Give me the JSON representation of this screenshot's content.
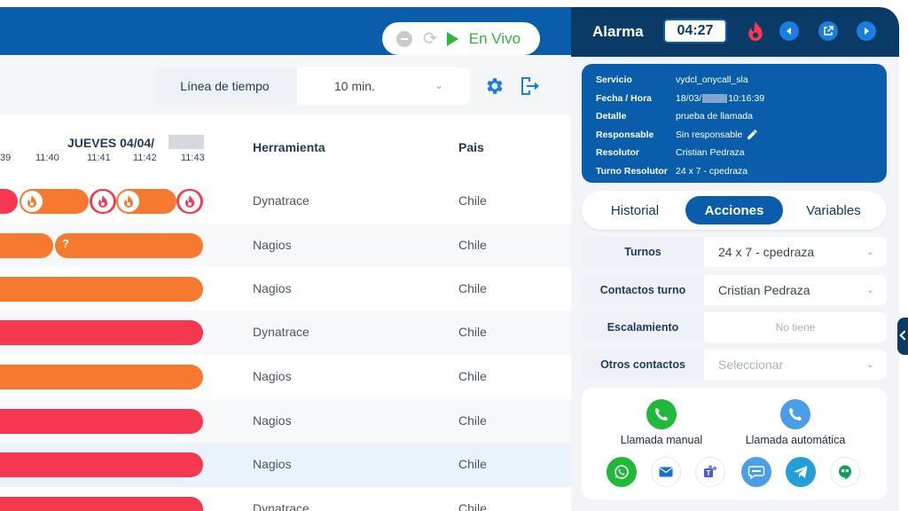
{
  "header": {
    "live_label": "En Vivo",
    "icons": [
      "stop-icon",
      "refresh-icon",
      "play-icon"
    ]
  },
  "controls": {
    "timeline_label": "Línea de tiempo",
    "interval_value": "10 min.",
    "icons": [
      "gear-icon",
      "exit-icon"
    ]
  },
  "table": {
    "date_heading": "JUEVES 04/04/",
    "ticks": [
      "39",
      "11:40",
      "11:41",
      "11:42",
      "11:43"
    ],
    "col_tool": "Herramienta",
    "col_country": "Pais",
    "rows": [
      {
        "tool": "Dynatrace",
        "country": "Chile"
      },
      {
        "tool": "Nagios",
        "country": "Chile"
      },
      {
        "tool": "Nagios",
        "country": "Chile"
      },
      {
        "tool": "Dynatrace",
        "country": "Chile"
      },
      {
        "tool": "Nagios",
        "country": "Chile"
      },
      {
        "tool": "Nagios",
        "country": "Chile"
      },
      {
        "tool": "Nagios",
        "country": "Chile"
      },
      {
        "tool": "Dynatrace",
        "country": "Chile"
      }
    ],
    "unknown_marker": "?",
    "colors": {
      "orange": "#f7782f",
      "red": "#f5384f",
      "selected_row": "#eaf2fb"
    }
  },
  "alarm": {
    "title": "Alarma",
    "timer": "04:27",
    "icons": [
      "flame-icon",
      "prev-icon",
      "external-link-icon",
      "next-icon"
    ],
    "info": {
      "servicio_key": "Servicio",
      "servicio_val": "vydcl_onycall_sla",
      "fecha_key": "Fecha / Hora",
      "fecha_val_a": "18/03/",
      "fecha_val_b": "10:16:39",
      "detalle_key": "Detalle",
      "detalle_val": "prueba de llamada",
      "responsable_key": "Responsable",
      "responsable_val": "Sin responsable",
      "resolutor_key": "Resolutor",
      "resolutor_val": "Cristian Pedraza",
      "turno_key": "Turno Resolutor",
      "turno_val": "24 x 7 - cpedraza"
    },
    "tabs": [
      "Historial",
      "Acciones",
      "Variables"
    ],
    "active_tab": "Acciones",
    "fields": {
      "turnos_label": "Turnos",
      "turnos_value": "24 x 7 - cpedraza",
      "contactos_label": "Contactos turno",
      "contactos_value": "Cristian Pedraza",
      "escalamiento_label": "Escalamiento",
      "escalamiento_value": "No tiene",
      "otros_label": "Otros contactos",
      "otros_placeholder": "Seleccionar"
    },
    "calls": {
      "manual_label": "Llamada manual",
      "auto_label": "Llamada automática"
    },
    "channels": [
      "whatsapp-icon",
      "mail-icon",
      "teams-icon",
      "sms-icon",
      "telegram-icon",
      "hangouts-icon"
    ],
    "colors": {
      "dark": "#0a3b66",
      "primary": "#0a5dab",
      "green": "#22b83a",
      "light_blue": "#4a9ee8"
    }
  }
}
